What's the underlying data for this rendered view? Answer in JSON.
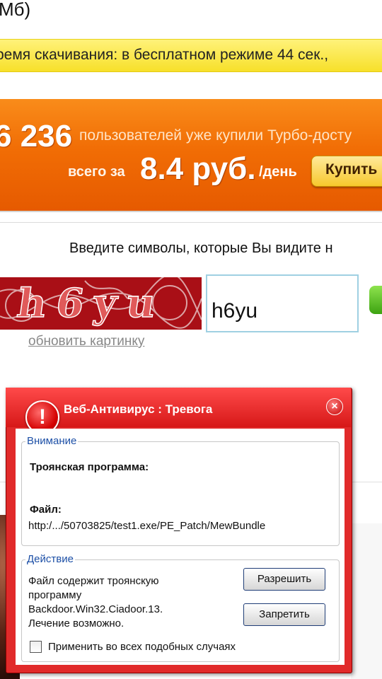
{
  "header": {
    "size_text": "Мб)"
  },
  "download_info": {
    "text": "ремя скачивания: в бесплатном режиме 44 сек.,"
  },
  "promo": {
    "count": "6 236",
    "users_text": "пользователей уже купили Турбо-досту",
    "for_text": "всего за",
    "price": "8.4 руб.",
    "per_day": "/день",
    "buy_label": "Купить"
  },
  "captcha": {
    "prompt": "Введите символы, которые Вы видите н",
    "image_text": "h6yu",
    "input_value": "h6yu",
    "refresh_link": "обновить картинку"
  },
  "antivirus": {
    "title": "Веб-Антивирус : Тревога",
    "alert_glyph": "!",
    "close_glyph": "×",
    "attention_group": "Внимание",
    "trojan_label": "Троянская программа:",
    "file_label": "Файл:",
    "file_path": "http:/.../50703825/test1.exe/PE_Patch/MewBundle",
    "action_group": "Действие",
    "action_line1": "Файл содержит троянскую",
    "action_line2": "программу",
    "action_line3": "Backdoor.Win32.Ciadoor.13.",
    "action_line4": "Лечение возможно.",
    "allow_button": "Разрешить",
    "deny_button": "Запретить",
    "apply_all_label": "Применить во всех подобных случаях"
  },
  "colors": {
    "promo_orange": "#f16d05",
    "alert_red": "#e12a2a",
    "group_label_blue": "#1c4fa6",
    "captcha_bg": "#a90f16"
  }
}
